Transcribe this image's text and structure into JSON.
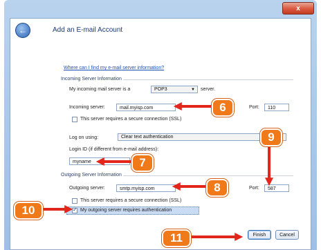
{
  "window": {
    "close_label": "x"
  },
  "header": {
    "title": "Add an E-mail Account"
  },
  "help_link": "Where can I find my e-mail server information?",
  "incoming": {
    "section_title": "Incoming Server Information",
    "server_type_prefix": "My incoming mail server is a",
    "server_type_value": "POP3",
    "server_type_suffix": "server.",
    "server_label": "Incoming server:",
    "server_value": "mail.myisp.com",
    "port_label": "Port:",
    "port_value": "110",
    "ssl_label": "This server requires a secure connection (SSL)",
    "logon_label": "Log on using:",
    "logon_value": "Clear text authentication",
    "login_id_label": "Login ID (if different from e-mail address):",
    "login_id_value": "myname"
  },
  "outgoing": {
    "section_title": "Outgoing Server Information",
    "server_label": "Outgoing server:",
    "server_value": "smtp.myisp.com",
    "port_label": "Port:",
    "port_value": "587",
    "ssl_label": "This server requires a secure connection (SSL)",
    "auth_label": "My outgoing server requires authentication"
  },
  "buttons": {
    "finish": "Finish",
    "cancel": "Cancel"
  },
  "callouts": {
    "c6": "6",
    "c7": "7",
    "c8": "8",
    "c9": "9",
    "c10": "10",
    "c11": "11"
  },
  "colors": {
    "callout": "#f07a1a",
    "arrow": "#e2261b",
    "window_frame": "#a7c6e9"
  }
}
